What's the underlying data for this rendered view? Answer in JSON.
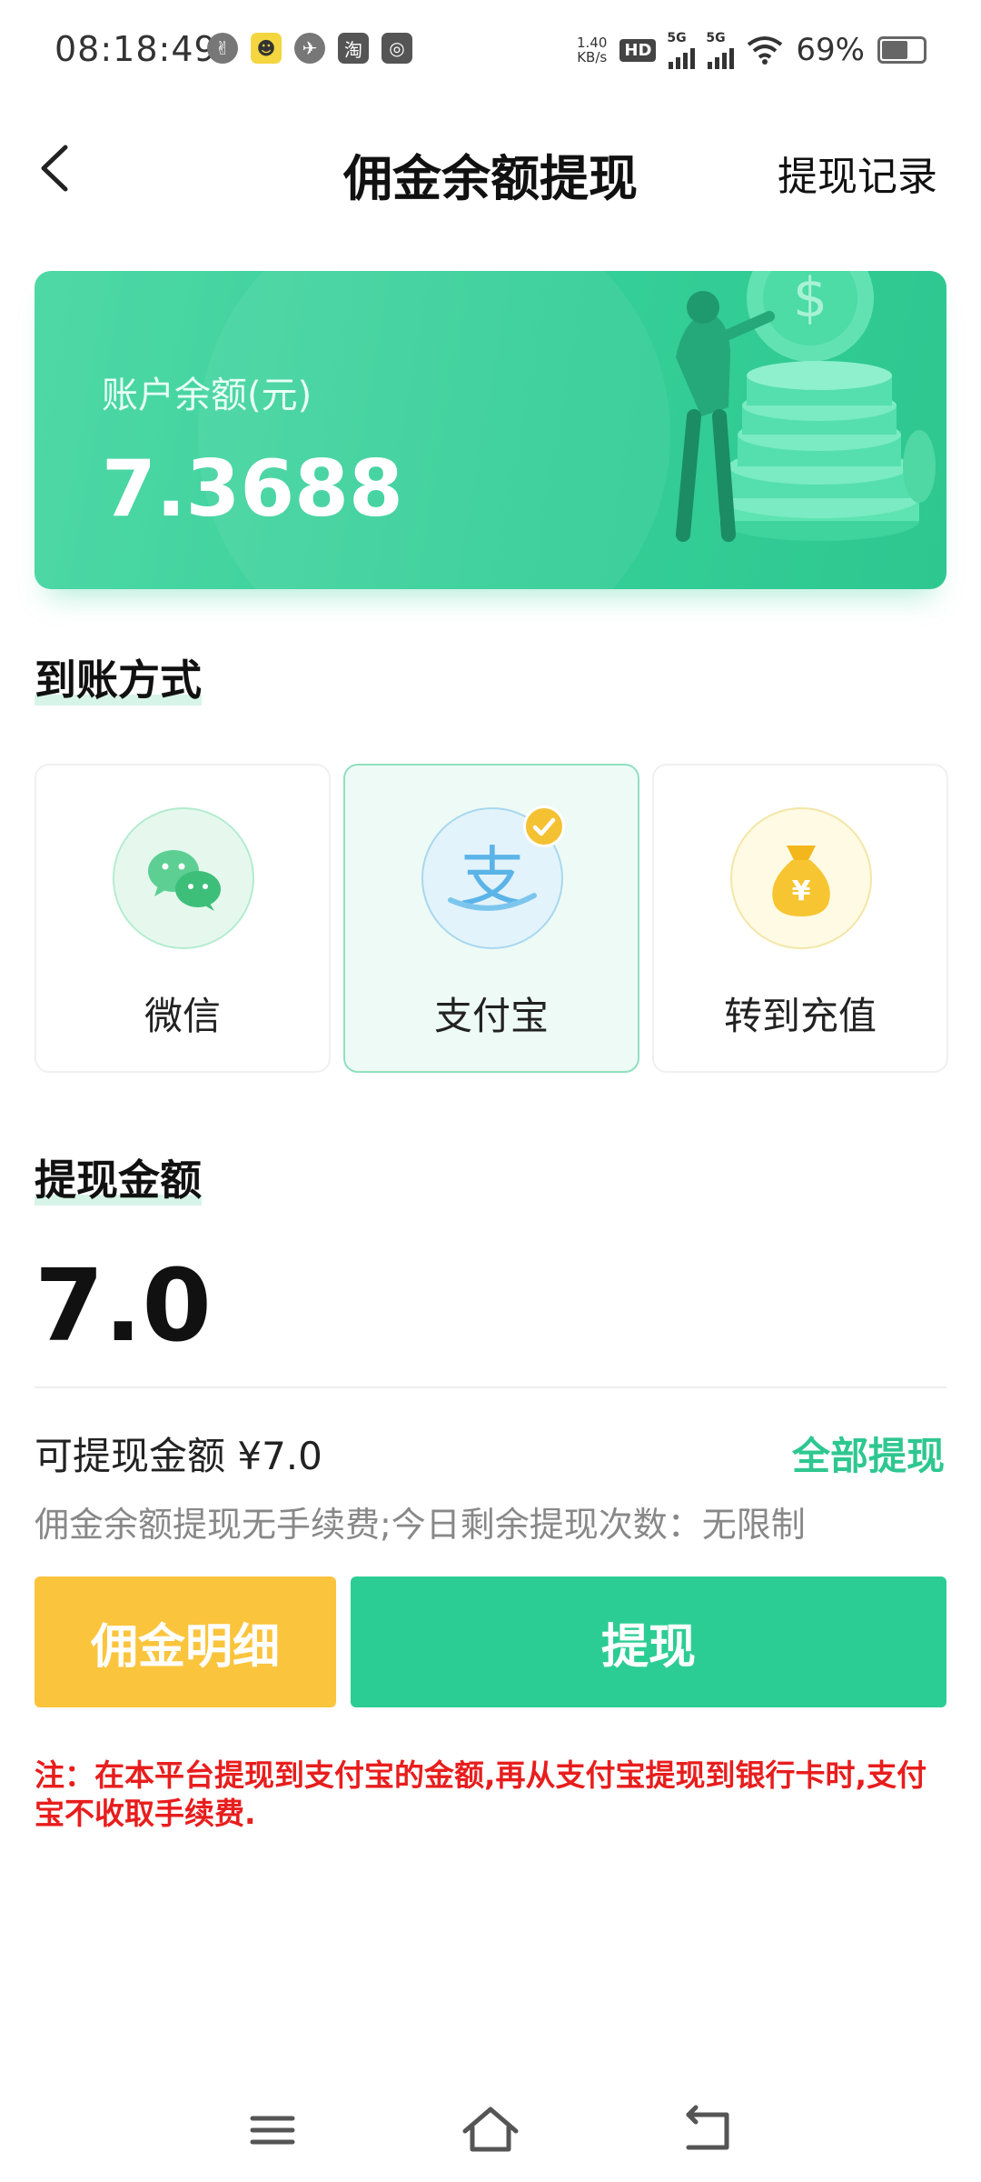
{
  "status_bar": {
    "time": "08:18:49",
    "net_speed_value": "1.40",
    "net_speed_unit": "KB/s",
    "hd_label": "HD",
    "sim1_tag": "5G",
    "sim2_tag": "5G",
    "battery_percent": "69%",
    "battery_level": 0.69
  },
  "header": {
    "title": "佣金余额提现",
    "history_link": "提现记录"
  },
  "balance_card": {
    "label": "账户余额(元)",
    "value": "7.3688"
  },
  "payment_section": {
    "title": "到账方式",
    "methods": [
      {
        "label": "微信",
        "icon": "wechat-icon",
        "selected": false
      },
      {
        "label": "支付宝",
        "icon": "alipay-icon",
        "selected": true
      },
      {
        "label": "转到充值",
        "icon": "money-bag-icon",
        "selected": false
      }
    ]
  },
  "amount_section": {
    "title": "提现金额",
    "amount": "7.0",
    "available_text": "可提现金额 ¥7.0",
    "withdraw_all_label": "全部提现",
    "fee_note": "佣金余额提现无手续费;今日剩余提现次数：无限制"
  },
  "buttons": {
    "detail_label": "佣金明细",
    "withdraw_label": "提现"
  },
  "note": "注：在本平台提现到支付宝的金额,再从支付宝提现到银行卡时,支付宝不收取手续费.",
  "colors": {
    "accent": "#2ccd94",
    "detail_button": "#fbc43d",
    "warning": "#e81d1d"
  }
}
